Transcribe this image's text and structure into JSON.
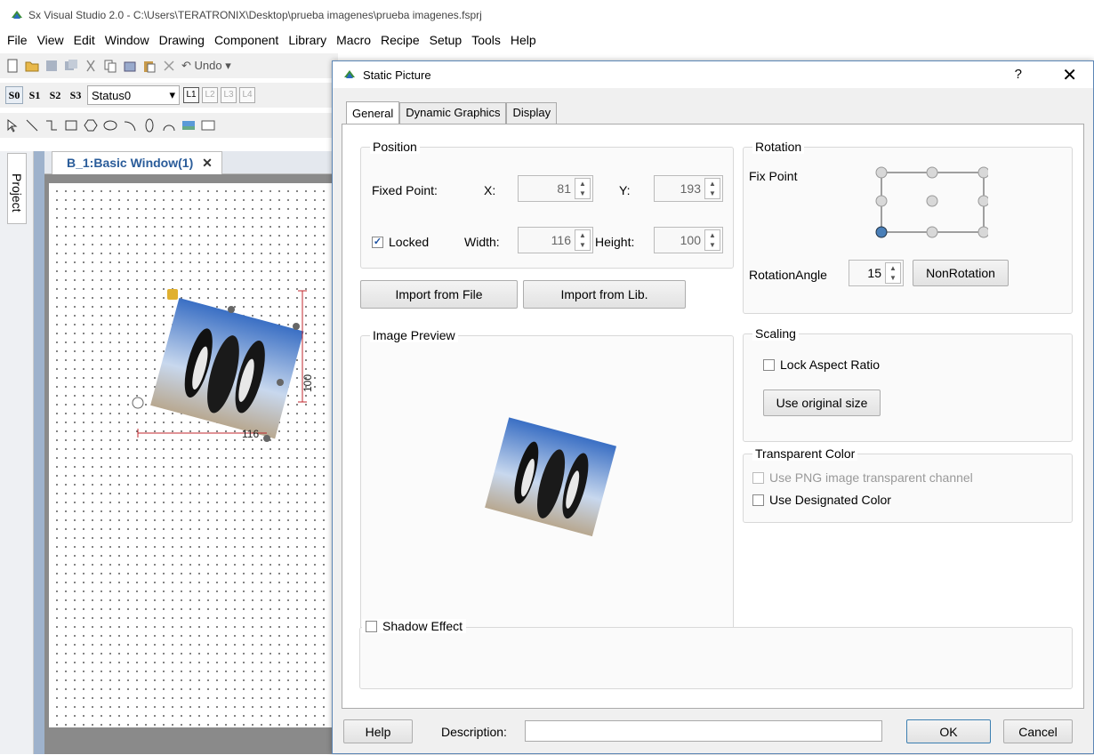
{
  "window_title": "Sx Visual Studio 2.0 - C:\\Users\\TERATRONIX\\Desktop\\prueba imagenes\\prueba imagenes.fsprj",
  "menu": [
    "File",
    "View",
    "Edit",
    "Window",
    "Drawing",
    "Component",
    "Library",
    "Macro",
    "Recipe",
    "Setup",
    "Tools",
    "Help"
  ],
  "toolbar": {
    "undo_label": "Undo",
    "status_value": "Status0",
    "state_buttons": [
      "S0",
      "S1",
      "S2",
      "S3"
    ],
    "layer_buttons": [
      "L1",
      "L2",
      "L3",
      "L4"
    ]
  },
  "project_tab": "Project",
  "window_tab": "B_1:Basic Window(1)",
  "canvas_dims": {
    "width": "116",
    "height": "100"
  },
  "dialog": {
    "title": "Static Picture",
    "help_glyph": "?",
    "close_glyph": "✕",
    "tabs": [
      "General",
      "Dynamic Graphics",
      "Display"
    ],
    "position": {
      "group_title": "Position",
      "fixed_point_label": "Fixed Point:",
      "x_label": "X:",
      "x_value": "81",
      "y_label": "Y:",
      "y_value": "193",
      "locked_label": "Locked",
      "locked_checked": true,
      "width_label": "Width:",
      "width_value": "116",
      "height_label": "Height:",
      "height_value": "100"
    },
    "import_file_button": "Import from File",
    "import_lib_button": "Import from Lib.",
    "image_preview_title": "Image Preview",
    "rotation": {
      "group_title": "Rotation",
      "fix_point_label": "Fix Point",
      "angle_label": "RotationAngle",
      "angle_value": "15",
      "nonrotation_button": "NonRotation"
    },
    "scaling": {
      "group_title": "Scaling",
      "lock_aspect_label": "Lock Aspect Ratio",
      "original_size_button": "Use original size"
    },
    "transparent": {
      "group_title": "Transparent Color",
      "png_channel_label": "Use PNG image transparent channel",
      "designated_label": "Use Designated Color"
    },
    "shadow_label": "Shadow Effect",
    "help_button": "Help",
    "description_label": "Description:",
    "description_value": "",
    "ok_button": "OK",
    "cancel_button": "Cancel"
  }
}
